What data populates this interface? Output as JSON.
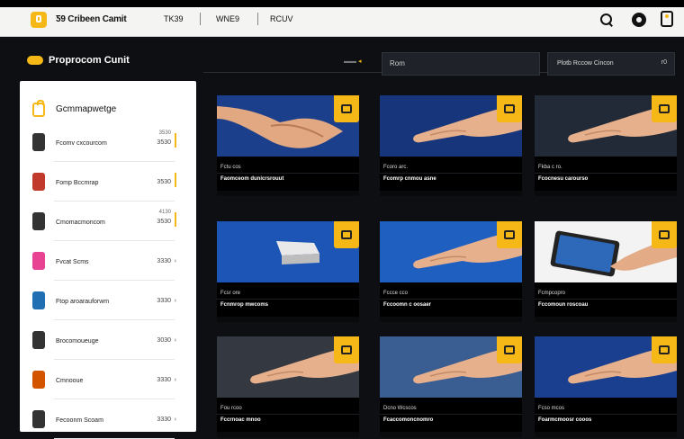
{
  "app": {
    "title": "Ƽ9 Cribeen Camit"
  },
  "nav": {
    "items": [
      "TK39",
      "WNE9",
      "RCUV"
    ]
  },
  "header": {
    "section_title": "Proprocom Cunit",
    "search_value": "Rom",
    "filter_label": "Plotb  Rccow  Cincon",
    "filter_value": "r0"
  },
  "sidebar": {
    "heading": "Gcmmapwetge",
    "items": [
      {
        "label": "Fcomv cxcourcom",
        "value": "3530",
        "value2": "3530",
        "icon": "bottle-icon",
        "color": "#333333"
      },
      {
        "label": "Fomp Bccmrap",
        "value": "3530",
        "value2": "",
        "icon": "jar-icon",
        "color": "#c0392b"
      },
      {
        "label": "Cmomacmoncom",
        "value": "3530",
        "value2": "4130",
        "icon": "bottle-icon",
        "color": "#333333"
      },
      {
        "label": "Fvcat Scms",
        "value": "3330",
        "value2": "",
        "icon": "box-icon",
        "color": "#e84393"
      },
      {
        "label": "Ftop aroarauforwm",
        "value": "3330",
        "value2": "",
        "icon": "can-icon",
        "color": "#1f6fb2"
      },
      {
        "label": "Brocomoueuge",
        "value": "3030",
        "value2": "",
        "icon": "frame-icon",
        "color": "#333333"
      },
      {
        "label": "Cmnooue",
        "value": "3330",
        "value2": "",
        "icon": "spray-icon",
        "color": "#d35400"
      },
      {
        "label": "Fecoonm Scoam",
        "value": "3330",
        "value2": "",
        "icon": "tool-icon",
        "color": "#333333"
      }
    ]
  },
  "cards": [
    {
      "meta": "Fctu  cos",
      "name": "Faomceom dunicrsrouut",
      "scene": "handshake",
      "bg": "#1b3f8a"
    },
    {
      "meta": "Fcoro  arc.",
      "name": "Fcomrp cnmou  asne",
      "scene": "hand",
      "bg": "#17357a"
    },
    {
      "meta": "Fkba  c  ro.",
      "name": "Fcocnesu  carourso",
      "scene": "hand",
      "bg": "#222a38"
    },
    {
      "meta": "Fcsr  ore",
      "name": "Fcnmrop  mwcoms",
      "scene": "block",
      "bg": "#1c55b5"
    },
    {
      "meta": "Fccce  cco",
      "name": "Fccoomn  c  oosaer",
      "scene": "hand",
      "bg": "#1f5fc0"
    },
    {
      "meta": "Fcmpcopro",
      "name": "Fccomoun  roscoau",
      "scene": "tablet",
      "bg": "#f3f3f3"
    },
    {
      "meta": "Fou  rcoo",
      "name": "Fccrnoac  mnoo",
      "scene": "hand",
      "bg": "#343840"
    },
    {
      "meta": "Dcno  Wcscos",
      "name": "Fcaccomoncnomro",
      "scene": "hand",
      "bg": "#3a5d92"
    },
    {
      "meta": "Fcso  mcos",
      "name": "Foarmcmoosr  cooos",
      "scene": "hand",
      "bg": "#1a3f8e"
    }
  ],
  "colors": {
    "accent": "#f5b817",
    "background": "#0d0f12"
  }
}
